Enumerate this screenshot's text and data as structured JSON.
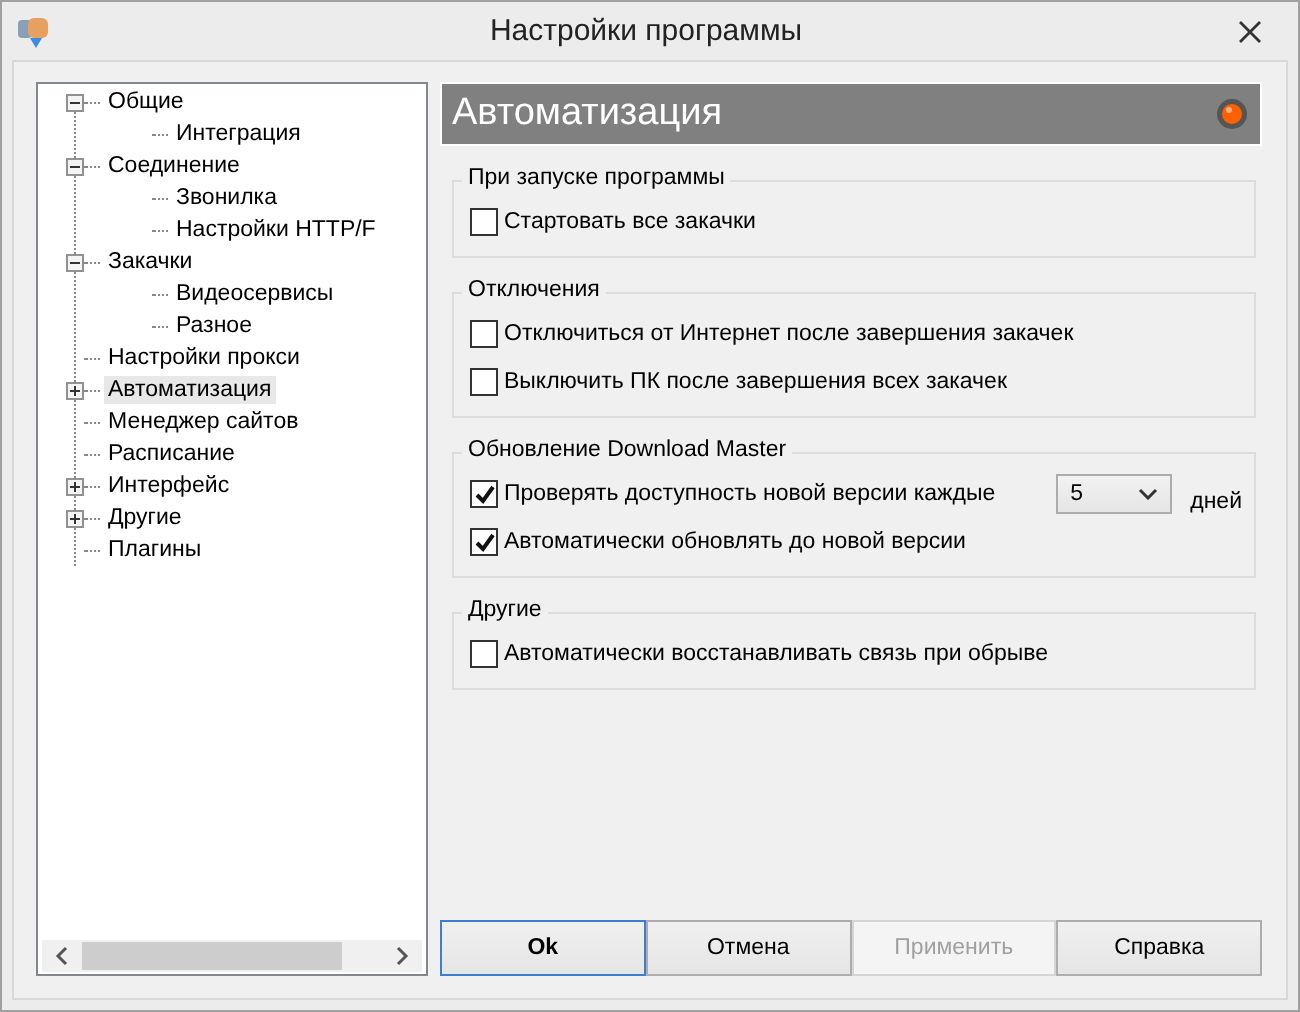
{
  "window": {
    "title": "Настройки программы"
  },
  "tree": [
    {
      "label": "Общие",
      "expanded": true,
      "selected": false,
      "children": [
        {
          "label": "Интеграция",
          "selected": false
        }
      ]
    },
    {
      "label": "Соединение",
      "expanded": true,
      "selected": false,
      "children": [
        {
          "label": "Звонилка",
          "selected": false
        },
        {
          "label": "Настройки HTTP/F",
          "selected": false
        }
      ]
    },
    {
      "label": "Закачки",
      "expanded": true,
      "selected": false,
      "children": [
        {
          "label": "Видеосервисы",
          "selected": false
        },
        {
          "label": "Разное",
          "selected": false
        }
      ]
    },
    {
      "label": "Настройки прокси",
      "selected": false
    },
    {
      "label": "Автоматизация",
      "expanded": false,
      "selected": true
    },
    {
      "label": "Менеджер сайтов",
      "selected": false
    },
    {
      "label": "Расписание",
      "selected": false
    },
    {
      "label": "Интерфейс",
      "expanded": false,
      "selected": false
    },
    {
      "label": "Другие",
      "expanded": false,
      "selected": false
    },
    {
      "label": "Плагины",
      "selected": false
    }
  ],
  "panel": {
    "title": "Автоматизация"
  },
  "groups": [
    {
      "title": "При запуске программы",
      "options": [
        {
          "label": "Стартовать все закачки",
          "checked": false
        }
      ]
    },
    {
      "title": "Отключения",
      "options": [
        {
          "label": "Отключиться от Интернет после завершения закачек",
          "checked": false
        },
        {
          "label": "Выключить ПК после завершения всех закачек",
          "checked": false
        }
      ]
    },
    {
      "title": "Обновление Download Master",
      "options": [
        {
          "label": "Проверять доступность новой версии каждые",
          "checked": true,
          "select": {
            "value": "5",
            "unit": "дней"
          }
        },
        {
          "label": "Автоматически обновлять до новой версии",
          "checked": true
        }
      ]
    },
    {
      "title": "Другие",
      "options": [
        {
          "label": "Автоматически восстанавливать связь при обрыве",
          "checked": false
        }
      ]
    }
  ],
  "buttons": [
    {
      "label": "Ok",
      "default": true,
      "disabled": false
    },
    {
      "label": "Отмена",
      "default": false,
      "disabled": false
    },
    {
      "label": "Применить",
      "default": false,
      "disabled": true
    },
    {
      "label": "Справка",
      "default": false,
      "disabled": false
    }
  ]
}
